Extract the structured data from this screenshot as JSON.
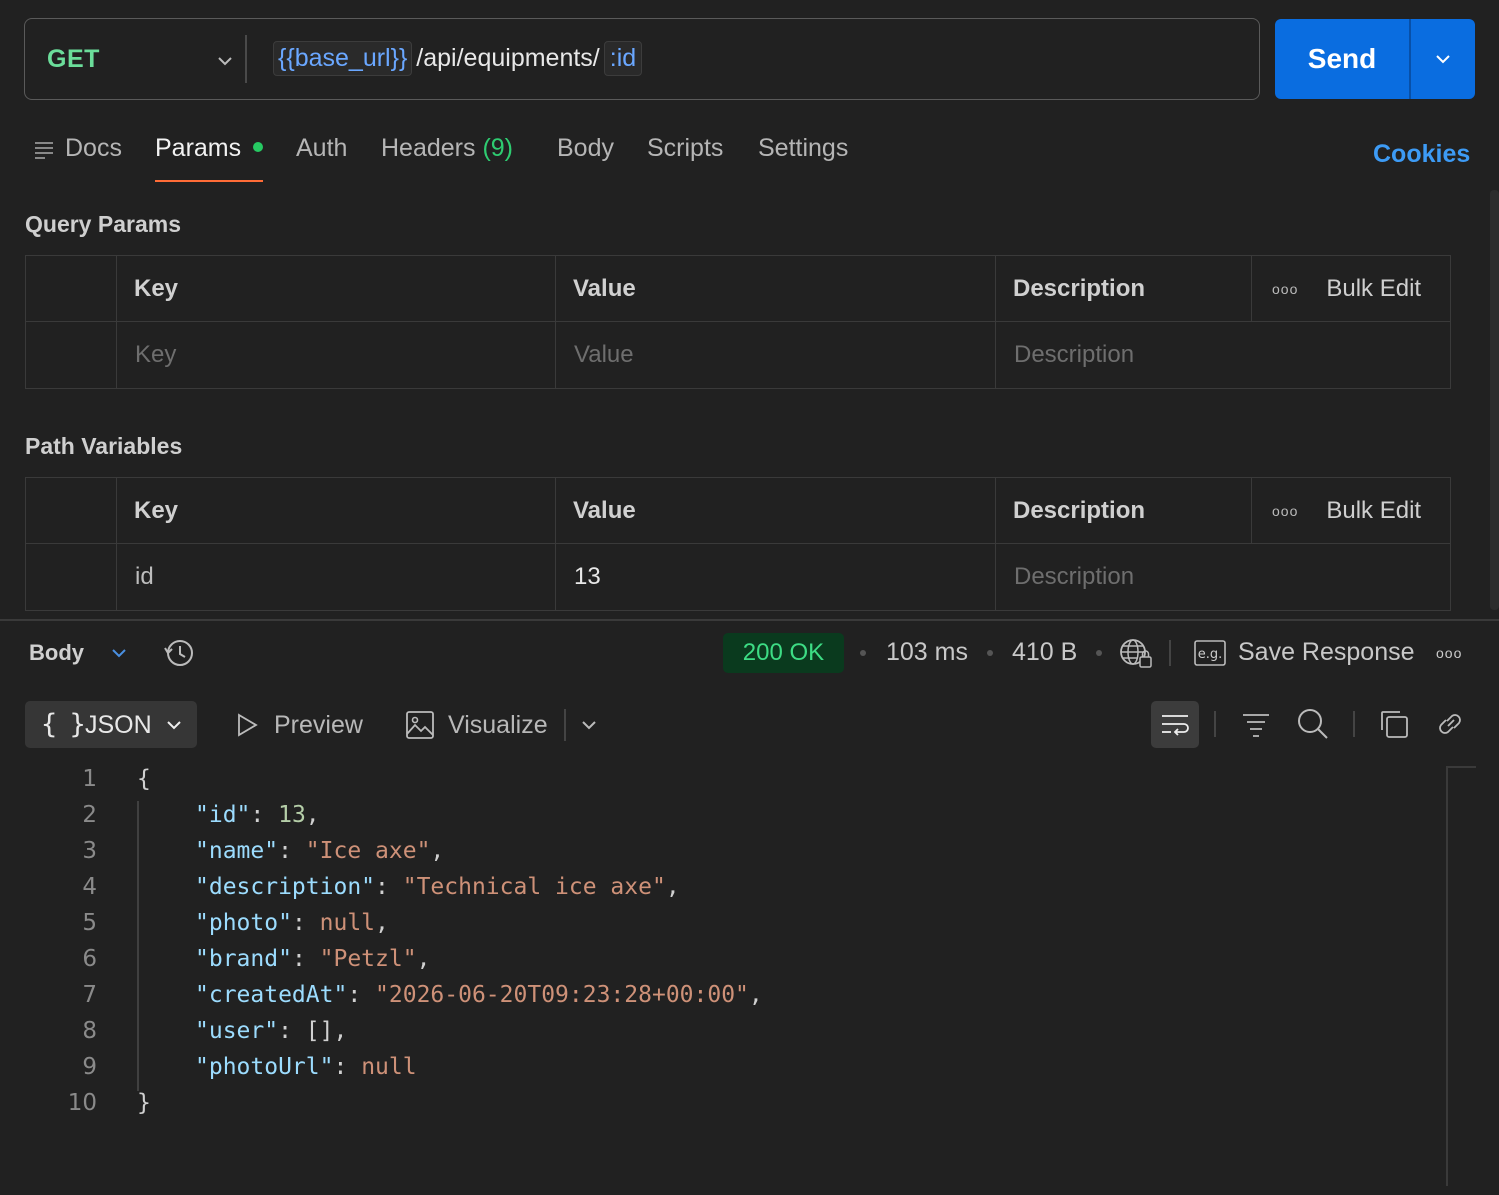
{
  "request": {
    "method": "GET",
    "url_variable": "{{base_url}}",
    "url_path": "/api/equipments/",
    "path_param": ":id",
    "send_label": "Send"
  },
  "tabs": {
    "docs": "Docs",
    "params": "Params",
    "auth": "Auth",
    "headers": "Headers",
    "headers_count": "(9)",
    "body": "Body",
    "scripts": "Scripts",
    "settings": "Settings",
    "cookies": "Cookies"
  },
  "query_params": {
    "title": "Query Params",
    "headers": [
      "Key",
      "Value",
      "Description"
    ],
    "bulk_edit": "Bulk Edit",
    "placeholder": {
      "key": "Key",
      "value": "Value",
      "description": "Description"
    }
  },
  "path_variables": {
    "title": "Path Variables",
    "headers": [
      "Key",
      "Value",
      "Description"
    ],
    "bulk_edit": "Bulk Edit",
    "rows": [
      {
        "key": "id",
        "value": "13",
        "description_placeholder": "Description"
      }
    ]
  },
  "response": {
    "body_label": "Body",
    "status": "200 OK",
    "time": "103 ms",
    "size": "410 B",
    "save_response": "Save Response",
    "format": "JSON",
    "preview": "Preview",
    "visualize": "Visualize"
  },
  "code_lines": [
    "{",
    "\"id\": 13,",
    "\"name\": \"Ice axe\",",
    "\"description\": \"Technical ice axe\",",
    "\"photo\": null,",
    "\"brand\": \"Petzl\",",
    "\"createdAt\": \"2026-06-20T09:23:28+00:00\",",
    "\"user\": [],",
    "\"photoUrl\": null",
    "}"
  ],
  "colors": {
    "method": "#6bdd9a",
    "send": "#0a6de0",
    "cookies": "#3d9bf5",
    "status_text": "#3ddc84",
    "active_tab_underline": "#ff6c37"
  }
}
